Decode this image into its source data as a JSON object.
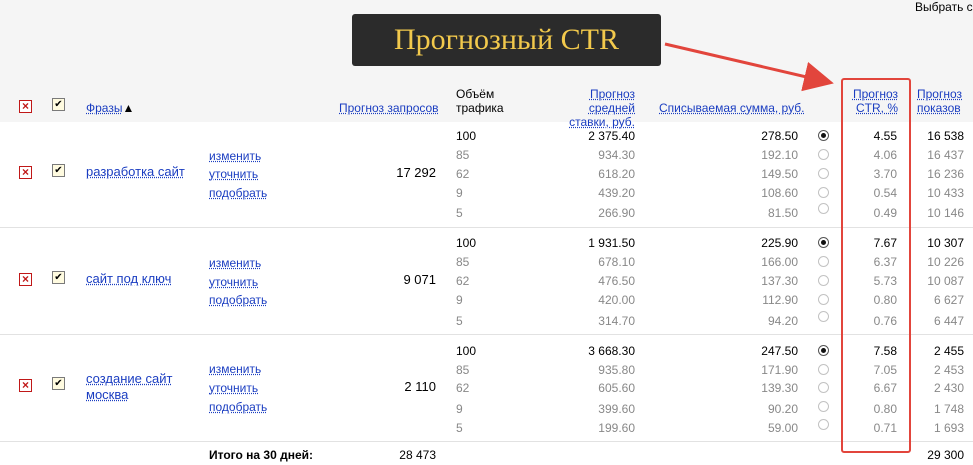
{
  "header": {
    "select_label": "Выбрать с",
    "callout": "Прогнозный CTR",
    "col_phrases": "Фразы",
    "sort_arrow": "▲",
    "col_forecast_requests": "Прогноз запросов",
    "col_traffic_1": "Объём",
    "col_traffic_2": "трафика",
    "col_bid_1": "Прогноз средней",
    "col_bid_2": "ставки, руб.",
    "col_charge": "Списываемая сумма, руб.",
    "col_ctr_1": "Прогноз",
    "col_ctr_2": "CTR, %",
    "col_shows_1": "Прогноз",
    "col_shows_2": "показов"
  },
  "actions": {
    "change": "изменить",
    "refine": "уточнить",
    "pick": "подобрать"
  },
  "groups": [
    {
      "phrase_line1": "разработка сайт",
      "phrase_line2": "",
      "requests": "17 292",
      "rows": [
        {
          "traffic": "100",
          "bid": "2 375.40",
          "charge": "278.50",
          "ctr": "4.55",
          "shows": "16 538",
          "selected": true
        },
        {
          "traffic": "85",
          "bid": "934.30",
          "charge": "192.10",
          "ctr": "4.06",
          "shows": "16 437",
          "selected": false
        },
        {
          "traffic": "62",
          "bid": "618.20",
          "charge": "149.50",
          "ctr": "3.70",
          "shows": "16 236",
          "selected": false
        },
        {
          "traffic": "9",
          "bid": "439.20",
          "charge": "108.60",
          "ctr": "0.54",
          "shows": "10 433",
          "selected": false
        },
        {
          "traffic": "5",
          "bid": "266.90",
          "charge": "81.50",
          "ctr": "0.49",
          "shows": "10 146",
          "selected": false
        }
      ]
    },
    {
      "phrase_line1": "сайт под ключ",
      "phrase_line2": "",
      "requests": "9 071",
      "rows": [
        {
          "traffic": "100",
          "bid": "1 931.50",
          "charge": "225.90",
          "ctr": "7.67",
          "shows": "10 307",
          "selected": true
        },
        {
          "traffic": "85",
          "bid": "678.10",
          "charge": "166.00",
          "ctr": "6.37",
          "shows": "10 226",
          "selected": false
        },
        {
          "traffic": "62",
          "bid": "476.50",
          "charge": "137.30",
          "ctr": "5.73",
          "shows": "10 087",
          "selected": false
        },
        {
          "traffic": "9",
          "bid": "420.00",
          "charge": "112.90",
          "ctr": "0.80",
          "shows": "6 627",
          "selected": false
        },
        {
          "traffic": "5",
          "bid": "314.70",
          "charge": "94.20",
          "ctr": "0.76",
          "shows": "6 447",
          "selected": false
        }
      ]
    },
    {
      "phrase_line1": "создание сайт",
      "phrase_line2": "москва",
      "requests": "2 110",
      "rows": [
        {
          "traffic": "100",
          "bid": "3 668.30",
          "charge": "247.50",
          "ctr": "7.58",
          "shows": "2 455",
          "selected": true
        },
        {
          "traffic": "85",
          "bid": "935.80",
          "charge": "171.90",
          "ctr": "7.05",
          "shows": "2 453",
          "selected": false
        },
        {
          "traffic": "62",
          "bid": "605.60",
          "charge": "139.30",
          "ctr": "6.67",
          "shows": "2 430",
          "selected": false
        },
        {
          "traffic": "9",
          "bid": "399.60",
          "charge": "90.20",
          "ctr": "0.80",
          "shows": "1 748",
          "selected": false
        },
        {
          "traffic": "5",
          "bid": "199.60",
          "charge": "59.00",
          "ctr": "0.71",
          "shows": "1 693",
          "selected": false
        }
      ]
    }
  ],
  "totals": {
    "label": "Итого на 30 дней:",
    "requests": "28 473",
    "shows": "29 300"
  },
  "colors": {
    "link": "#1a3dc1",
    "highlight": "#e2453c",
    "callout_bg": "#2b2b2b",
    "callout_text": "#f2c94c"
  }
}
